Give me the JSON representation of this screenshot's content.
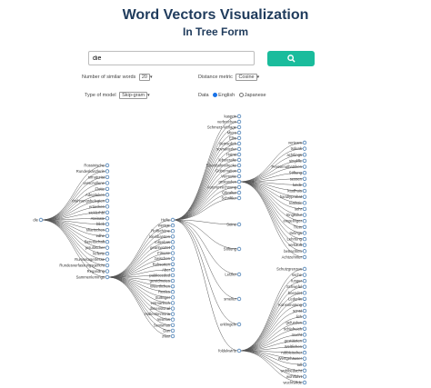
{
  "header": {
    "title": "Word Vectors Visualization",
    "subtitle": "In Tree Form"
  },
  "search": {
    "value": "die",
    "button_icon": "search-icon"
  },
  "controls": {
    "similar_label": "Number of similar words",
    "similar_value": "20",
    "distance_label": "Distance metric",
    "distance_value": "Cosine",
    "model_label": "Type of model",
    "model_value": "Skip-gram",
    "data_label": "Data",
    "data_options": [
      "English",
      "Japanese"
    ],
    "data_selected": "English"
  },
  "tree": {
    "root": "die",
    "level1": [
      "Rossinische",
      "Rundeskanzlerin",
      "sirnaturist",
      "verschollene",
      "Flotte",
      "Adepiteken",
      "rbahnungsbelegten",
      "ertiecken",
      "sicklerhbl",
      "Ateinate",
      "blieb",
      "sharischen",
      "edhe",
      "Bereitschaft",
      "jesuitischer",
      "lieferte",
      "Rumsetagetresse",
      "Rundesverfassungsgericht",
      "Regarding",
      "Sammenlernings"
    ],
    "level2": [
      "Hefte",
      "wenige",
      "Rollschöne",
      "kleinbarsten",
      "rollenbas",
      "geantwortet",
      "Fitnese",
      "zwischen",
      "Rebsorten",
      "Aber",
      "publiceeded",
      "gewidmetes",
      "Weertlichen",
      "Reales",
      "Sullinger",
      "entmarlisch",
      "dimensional",
      "Hallentimmoria",
      "reiselos",
      "Sexismus",
      "Dan",
      "zwar"
    ],
    "level3": [
      "kasprin",
      "verbrechen",
      "Schmerz-Verlage",
      "Micro",
      "Elbs",
      "demsglich",
      "sovrakterler",
      "Hairst",
      "lebuteralte",
      "Eisenbahnstrecke",
      "Gobernation",
      "Vermutte",
      "gestanden",
      "Autorenrechnung",
      "Gibraltar",
      "Schriftler",
      "Seine",
      "Stiftung",
      "Letzler",
      "smelter",
      "erklingeln",
      "foldekwirts"
    ],
    "level4a": [
      "verteam",
      "tsdenk",
      "achtlings",
      "singlifle",
      "Pressenalbatriken",
      "Stiftung",
      "sessen",
      "lunde",
      "ktudhuis",
      "handlyprobat",
      "realistic",
      "sehr",
      "tringkulur",
      "eingelinger",
      "Trein",
      "trelings",
      "Lehrtung",
      "verkauft",
      "betrachten",
      "Achtzehnter"
    ],
    "level4b": [
      "Schutzgrenzen",
      "ssche",
      "lunger",
      "Schwefel",
      "beendet",
      "Lederlin",
      "Konsomateng",
      "sonst",
      "lich",
      "gefunden",
      "schlafreich",
      "mucht",
      "gestützten",
      "Weltlichen",
      "rubbleischer",
      "Wertgehäuser",
      "toll",
      "wohlbedacht",
      "wohlfahrt",
      "wuchtwilde"
    ]
  }
}
